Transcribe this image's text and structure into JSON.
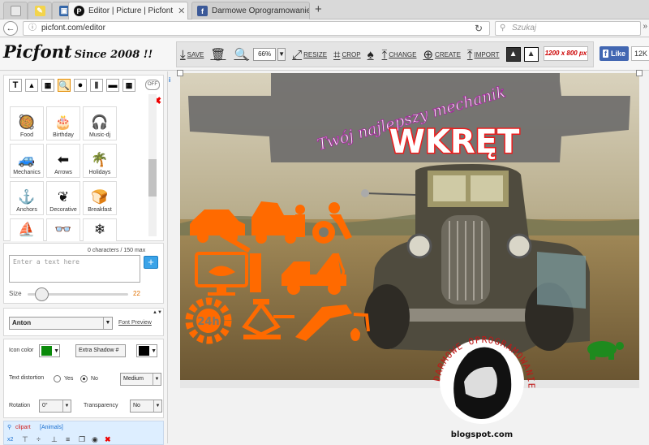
{
  "browser": {
    "tabs": [
      {
        "title": "Editor | Picture | Picfont",
        "active": true
      },
      {
        "title": "Darmowe Oprogramowanie",
        "active": false
      }
    ],
    "url": "picfont.com/editor",
    "search_placeholder": "Szukaj"
  },
  "header": {
    "logo": "Picfont",
    "since": "Since 2008 !!",
    "tools": {
      "save": "SAVE",
      "zoom": "66%",
      "resize": "RESIZE",
      "crop": "CROP",
      "change": "CHANGE",
      "create": "CREATE",
      "import": "IMPORT"
    },
    "canvas_size": "1200 x 800 px",
    "fb_like": "Like",
    "fb_count": "12K"
  },
  "sidebar": {
    "off_label": "OFF",
    "clipart": [
      {
        "label": "Food",
        "icon": "🥘"
      },
      {
        "label": "Birthday",
        "icon": "🎂"
      },
      {
        "label": "Music-dj",
        "icon": "🎧"
      },
      {
        "label": "Mechanics",
        "icon": "🚙"
      },
      {
        "label": "Arrows",
        "icon": "⬅"
      },
      {
        "label": "Holidays",
        "icon": "🌴"
      },
      {
        "label": "Anchors",
        "icon": "⚓"
      },
      {
        "label": "Decorative",
        "icon": "❦"
      },
      {
        "label": "Breakfast",
        "icon": "🍞"
      },
      {
        "label": "",
        "icon": "⛵"
      },
      {
        "label": "",
        "icon": "👓"
      },
      {
        "label": "",
        "icon": "❄"
      }
    ],
    "text": {
      "char_count": "0 characters / 150 max",
      "placeholder": "Enter a text here",
      "size_label": "Size",
      "size_value": "22",
      "size_fraction": 0.09
    },
    "font": {
      "name": "Anton",
      "preview_link": "Font Preview"
    },
    "icon_color": {
      "label": "Icon color",
      "color": "#0a8a0a",
      "shadow_option": "Extra Shadow #",
      "shadow_color": "#000000"
    },
    "distortion": {
      "label": "Text distortion",
      "yes": "Yes",
      "no": "No",
      "selected": "No",
      "level": "Medium"
    },
    "rotation": {
      "label": "Rotation",
      "value": "0°",
      "transparency_label": "Transparency",
      "transparency_value": "No"
    },
    "layers": {
      "item": "clipart",
      "item_detail": "[Animals]",
      "scale": "x2"
    }
  },
  "canvas": {
    "subtitle": "Twój najlepszy mechanik",
    "title": "WKRĘT",
    "icon_color": "#ff6a00",
    "title_color": "#ff2020",
    "subtitle_color": "#ffffff",
    "subtitle_outline": "#b0309a"
  },
  "watermark": {
    "ring_text": "DARMOWE OPROGRAMOWANIE",
    "url": "blogspot.com"
  }
}
